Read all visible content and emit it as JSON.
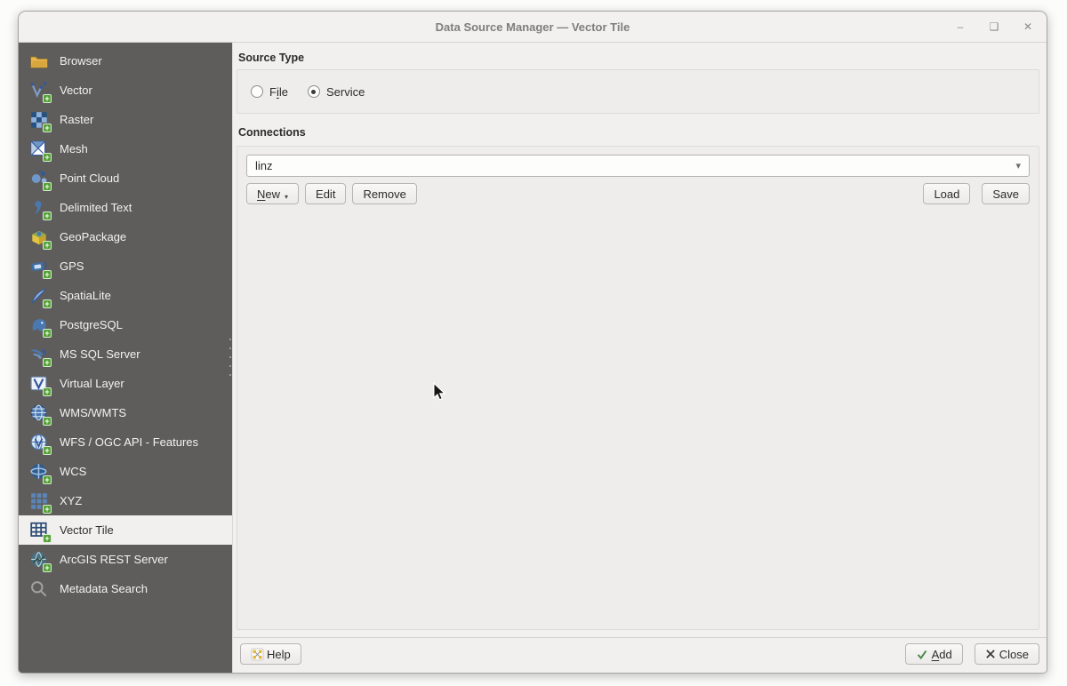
{
  "window": {
    "title": "Data Source Manager — Vector Tile",
    "controls": [
      {
        "name": "minimize",
        "glyph": "–"
      },
      {
        "name": "maximize",
        "glyph": "❑"
      },
      {
        "name": "close",
        "glyph": "✕"
      }
    ]
  },
  "icons": {
    "plus_badge": "+",
    "dropdown_arrow": "▾",
    "menu_arrow": "▾"
  },
  "sidebar": {
    "selected": "Vector Tile",
    "items": [
      {
        "label": "Browser",
        "icon": "browser-folder"
      },
      {
        "label": "Vector",
        "icon": "vector-layer"
      },
      {
        "label": "Raster",
        "icon": "raster-layer"
      },
      {
        "label": "Mesh",
        "icon": "mesh-layer"
      },
      {
        "label": "Point Cloud",
        "icon": "point-cloud"
      },
      {
        "label": "Delimited Text",
        "icon": "delimited-text"
      },
      {
        "label": "GeoPackage",
        "icon": "geopackage"
      },
      {
        "label": "GPS",
        "icon": "gps"
      },
      {
        "label": "SpatiaLite",
        "icon": "spatialite"
      },
      {
        "label": "PostgreSQL",
        "icon": "postgresql"
      },
      {
        "label": "MS SQL Server",
        "icon": "ms-sql-server"
      },
      {
        "label": "Virtual Layer",
        "icon": "virtual-layer"
      },
      {
        "label": "WMS/WMTS",
        "icon": "wms-wmts-globe"
      },
      {
        "label": "WFS / OGC API - Features",
        "icon": "wfs-ogc-globe"
      },
      {
        "label": "WCS",
        "icon": "wcs-globe"
      },
      {
        "label": "XYZ",
        "icon": "xyz-tiles"
      },
      {
        "label": "Vector Tile",
        "icon": "vector-tile-grid"
      },
      {
        "label": "ArcGIS REST Server",
        "icon": "arcgis-globe"
      },
      {
        "label": "Metadata Search",
        "icon": "metadata-search"
      }
    ]
  },
  "source_type": {
    "heading": "Source Type",
    "file": {
      "pre": "F",
      "key": "i",
      "post": "le",
      "selected": false
    },
    "service": {
      "label": "Service",
      "selected": true
    }
  },
  "connections": {
    "heading": "Connections",
    "value": "linz",
    "new": {
      "key": "N",
      "post": "ew"
    },
    "edit": "Edit",
    "remove": "Remove",
    "load": "Load",
    "save": "Save"
  },
  "footer": {
    "help": "Help",
    "add": {
      "key": "A",
      "post": "dd"
    },
    "close": "Close"
  }
}
